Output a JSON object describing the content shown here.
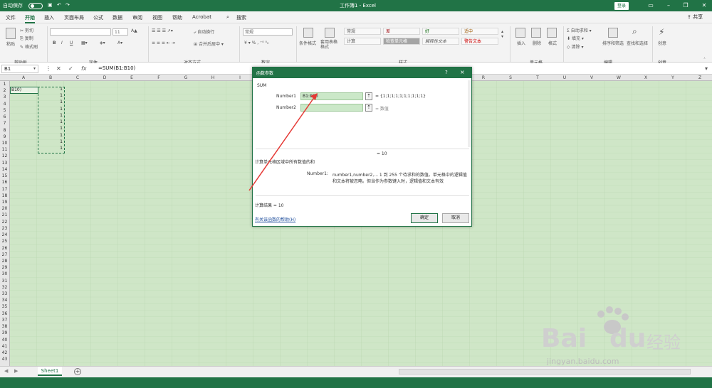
{
  "titlebar": {
    "autosave_label": "自动保存",
    "document_title": "工作簿1 - Excel",
    "login_label": "登录"
  },
  "menu": {
    "tabs": [
      "文件",
      "开始",
      "插入",
      "页面布局",
      "公式",
      "数据",
      "审阅",
      "视图",
      "帮助",
      "Acrobat"
    ],
    "search_label": "搜索",
    "share_label": "共享"
  },
  "ribbon": {
    "clipboard": {
      "paste": "粘贴",
      "cut": "剪切",
      "copy": "复制",
      "format_painter": "格式刷",
      "group": "剪贴板"
    },
    "font": {
      "group": "字体",
      "size": "11",
      "bold": "B",
      "italic": "I",
      "underline": "U"
    },
    "alignment": {
      "wrap": "自动换行",
      "merge": "合并后居中",
      "group": "对齐方式"
    },
    "number": {
      "format": "常规",
      "group": "数字"
    },
    "styles": {
      "cond": "条件格式",
      "table": "套用表格格式",
      "group": "样式",
      "cells": [
        "常规",
        "差",
        "好",
        "适中",
        "计算",
        "检查单元格",
        "解释性文本",
        "警告文本"
      ]
    },
    "cells": {
      "insert": "插入",
      "delete": "删除",
      "format": "格式",
      "group": "单元格"
    },
    "editing": {
      "autosum": "自动求和",
      "fill": "填充",
      "clear": "清除",
      "sort": "排序和筛选",
      "find": "查找和选择",
      "group": "编辑"
    },
    "ideas": {
      "label": "创意",
      "group": "创意"
    }
  },
  "formula_bar": {
    "name_box": "B1",
    "formula": "=SUM(B1:B10)",
    "fx": "fx"
  },
  "sheet": {
    "columns": [
      "A",
      "B",
      "C",
      "D",
      "E",
      "F",
      "G",
      "H",
      "I",
      "J",
      "K",
      "L",
      "M",
      "N",
      "O",
      "P",
      "Q",
      "R",
      "S",
      "T",
      "U",
      "V",
      "W",
      "X",
      "Y",
      "Z"
    ],
    "rows": [
      "1",
      "2",
      "3",
      "4",
      "5",
      "6",
      "7",
      "8",
      "9",
      "10",
      "11",
      "12",
      "13",
      "14",
      "15",
      "16",
      "17",
      "18",
      "19",
      "20",
      "21",
      "22",
      "23",
      "24",
      "25",
      "26",
      "27",
      "28",
      "29",
      "30",
      "31",
      "32",
      "33",
      "34",
      "35",
      "36",
      "37",
      "38",
      "39",
      "40",
      "41",
      "42",
      "43"
    ],
    "a1_text": "B10)",
    "b_values": [
      "1",
      "1",
      "1",
      "1",
      "1",
      "1",
      "1",
      "1",
      "1",
      "1"
    ]
  },
  "tabs": {
    "sheet1": "Sheet1",
    "add": "+"
  },
  "dialog": {
    "title": "函数参数",
    "help_q": "?",
    "close": "×",
    "function_name": "SUM",
    "number1_label": "Number1",
    "number1_value": "B1:B10",
    "number1_result": "=  {1;1;1;1;1;1;1;1;1;1}",
    "number2_label": "Number2",
    "number2_result": "=  数值",
    "total": "=   10",
    "description": "计算单元格区域中所有数值的和",
    "arg_name": "Number1:",
    "arg_desc1": "number1,number2,...   1 到 255 个待求和的数值。单元格中的逻辑值",
    "arg_desc2": "和文本将被忽略。但当作为参数键入时，逻辑值和文本有效",
    "result_label": "计算结果 =   10",
    "help_link": "有关该函数的帮助(H)",
    "ok": "确定",
    "cancel": "取消"
  },
  "watermark": {
    "brand": "Bai",
    "brand2": "du",
    "cn": "经验",
    "url": "jingyan.baidu.com"
  },
  "colors": {
    "excel_green": "#217346",
    "grid_fill": "#cfe6c7",
    "arrow": "#e53935"
  }
}
